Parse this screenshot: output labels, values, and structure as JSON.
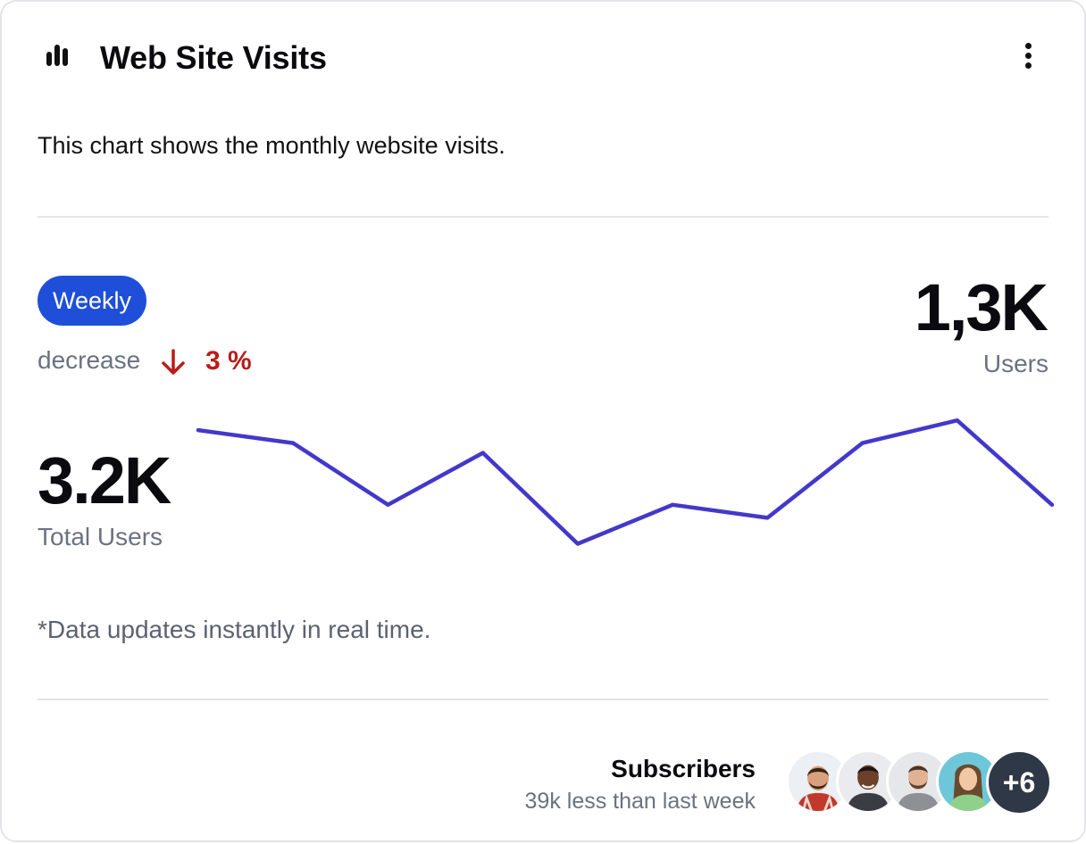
{
  "header": {
    "title": "Web Site Visits",
    "icon": "bar-chart-icon",
    "menu_icon": "more-vertical-icon"
  },
  "description": "This chart shows the monthly website visits.",
  "period": {
    "label": "Weekly",
    "color": "#1f4fd8"
  },
  "trend": {
    "label": "decrease",
    "icon": "arrow-down-icon",
    "value": "3 %",
    "color": "#b91c1c"
  },
  "users": {
    "value": "1,3K",
    "label": "Users"
  },
  "total": {
    "value": "3.2K",
    "label": "Total Users"
  },
  "note": "*Data updates instantly in real time.",
  "subscribers": {
    "title": "Subscribers",
    "subtitle": "39k less than last week",
    "more": "+6"
  },
  "chart_data": {
    "type": "line",
    "color": "#4338ca",
    "x": [
      0,
      1,
      2,
      3,
      4,
      5,
      6,
      7,
      8,
      9
    ],
    "values": [
      78,
      74,
      55,
      71,
      43,
      55,
      51,
      74,
      81,
      55
    ],
    "ylim": [
      0,
      100
    ],
    "grid": false
  }
}
